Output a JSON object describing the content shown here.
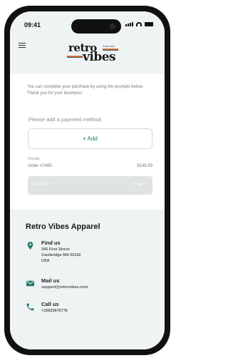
{
  "status_bar": {
    "time": "09:41"
  },
  "logo": {
    "line1": "retro",
    "line2": "vibes",
    "since": "SINCE 1994"
  },
  "checkout": {
    "intro": "You can complete your purchase by using the prompts below. Thank you for your business!",
    "payment_label": "Please add a payment method",
    "add_button": "+ Add",
    "details_label": "Details",
    "order_id": "Order #7485",
    "order_amount": "$149.99",
    "pay_bar_amount": "$149.99",
    "pay_bar_label": "Pay >"
  },
  "footer": {
    "brand": "Retro Vibes Apparel",
    "find_us": {
      "title": "Find us",
      "lines": [
        "245 First Street",
        "Cambridge MA 02142",
        "USA"
      ]
    },
    "mail_us": {
      "title": "Mail us",
      "lines": [
        "support@retrovibes.com"
      ]
    },
    "call_us": {
      "title": "Call us",
      "lines": [
        "+15625676776"
      ]
    }
  },
  "colors": {
    "accent": "#1f7a63",
    "header_bg": "#eef3f4",
    "disabled_bg": "#e0e3e4"
  }
}
